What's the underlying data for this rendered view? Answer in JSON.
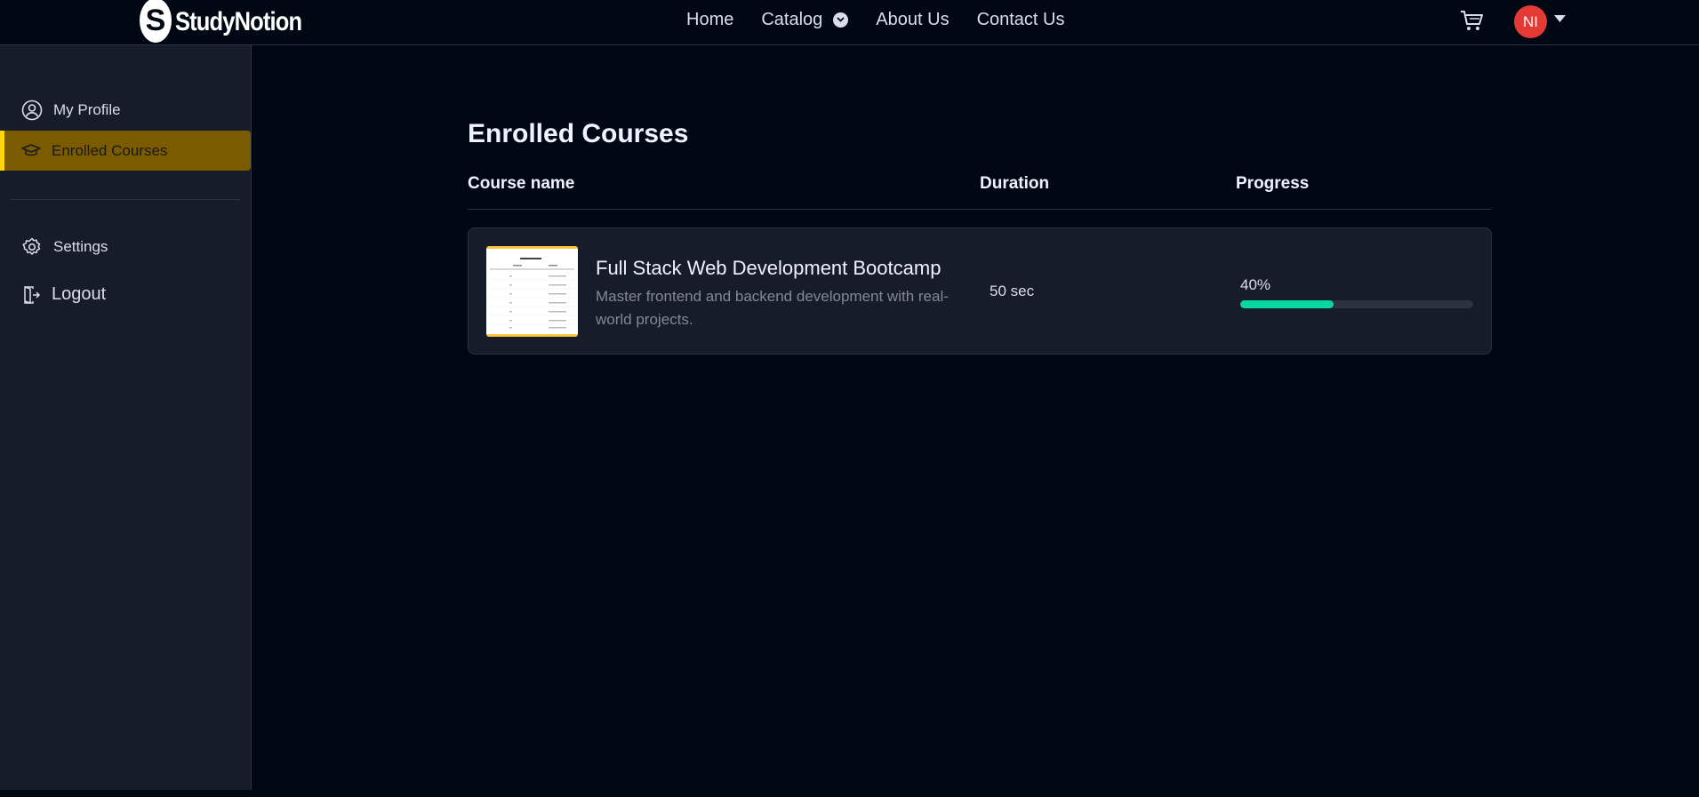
{
  "brand": {
    "name": "StudyNotion",
    "mark": "S"
  },
  "nav": {
    "links": [
      "Home",
      "Catalog",
      "About Us",
      "Contact Us"
    ]
  },
  "user": {
    "initials": "NI"
  },
  "sidebar": {
    "items": [
      {
        "label": "My Profile",
        "icon": "user-circle-icon"
      },
      {
        "label": "Enrolled Courses",
        "icon": "graduation-cap-icon",
        "active": true
      },
      {
        "label": "Settings",
        "icon": "gear-icon"
      },
      {
        "label": "Logout",
        "icon": "logout-icon"
      }
    ]
  },
  "main": {
    "title": "Enrolled Courses",
    "columns": [
      "Course name",
      "Duration",
      "Progress"
    ],
    "courses": [
      {
        "name": "Full Stack Web Development Bootcamp",
        "description": "Master frontend and backend development with real-world projects.",
        "duration": "50 sec",
        "progress_label": "40%",
        "progress_value": 40
      }
    ]
  },
  "colors": {
    "accent": "#ffd60a",
    "progress": "#06d6a0",
    "avatar": "#e53935",
    "background": "#000814",
    "sidebar": "#161d29"
  }
}
